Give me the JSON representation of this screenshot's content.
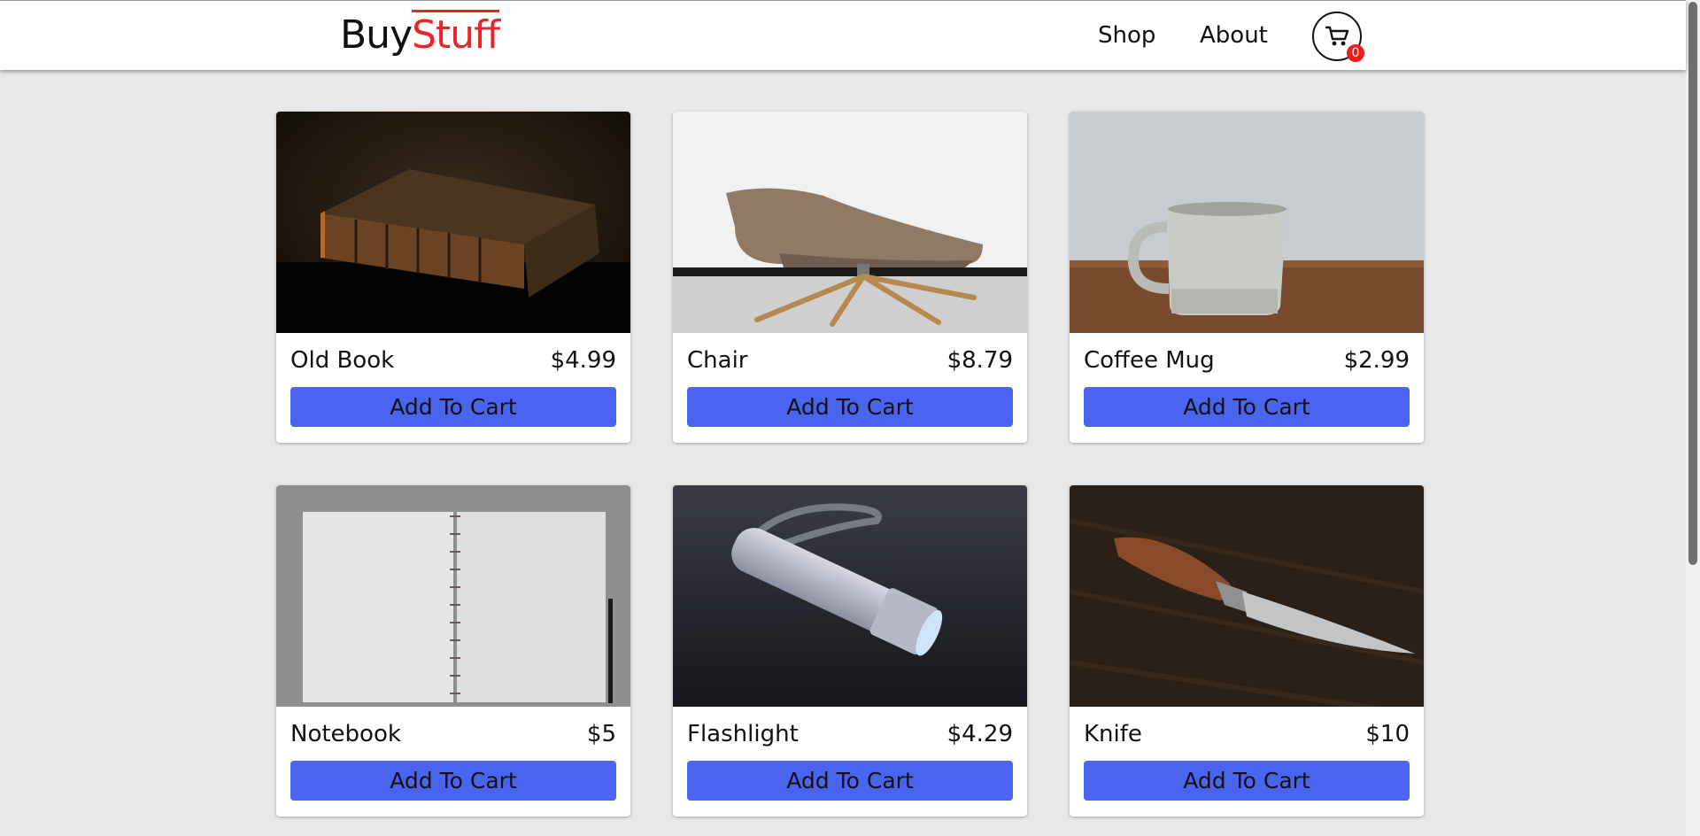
{
  "header": {
    "logo": {
      "part1": "Buy",
      "part2": "Stuff"
    },
    "nav": {
      "shop": "Shop",
      "about": "About"
    },
    "cart": {
      "count": "0",
      "icon": "cart-icon"
    }
  },
  "colors": {
    "accent": "#4b64f0",
    "brand_red": "#ea2525",
    "background": "#e8e8e8"
  },
  "products": [
    {
      "name": "Old Book",
      "price": "$4.99",
      "button": "Add To Cart",
      "image": "old-book-image"
    },
    {
      "name": "Chair",
      "price": "$8.79",
      "button": "Add To Cart",
      "image": "chair-image"
    },
    {
      "name": "Coffee Mug",
      "price": "$2.99",
      "button": "Add To Cart",
      "image": "coffee-mug-image"
    },
    {
      "name": "Notebook",
      "price": "$5",
      "button": "Add To Cart",
      "image": "notebook-image"
    },
    {
      "name": "Flashlight",
      "price": "$4.29",
      "button": "Add To Cart",
      "image": "flashlight-image"
    },
    {
      "name": "Knife",
      "price": "$10",
      "button": "Add To Cart",
      "image": "knife-image"
    }
  ]
}
